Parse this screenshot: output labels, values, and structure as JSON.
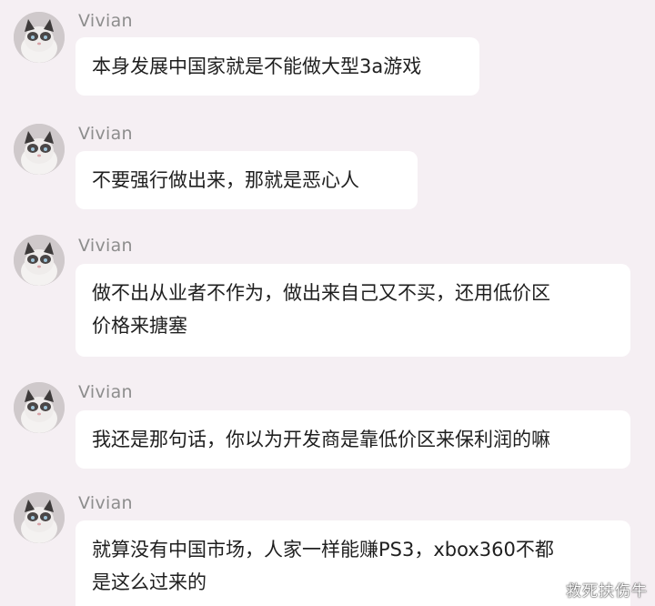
{
  "messages": [
    {
      "sender": "Vivian",
      "text": "本身发展中国家就是不能做大型3a游戏",
      "avatar_icon": "cat-avatar-icon"
    },
    {
      "sender": "Vivian",
      "text": "不要强行做出来，那就是恶心人",
      "avatar_icon": "cat-avatar-icon"
    },
    {
      "sender": "Vivian",
      "text": "做不出从业者不作为，做出来自己又不买，还用低价区\n价格来搪塞",
      "avatar_icon": "cat-avatar-icon"
    },
    {
      "sender": "Vivian",
      "text": "我还是那句话，你以为开发商是靠低价区来保利润的嘛",
      "avatar_icon": "cat-avatar-icon"
    },
    {
      "sender": "Vivian",
      "text": "就算没有中国市场，人家一样能赚PS3，xbox360不都\n是这么过来的",
      "avatar_icon": "cat-avatar-icon"
    }
  ],
  "watermark": "救死扶伤牛",
  "colors": {
    "background": "#f5eff3",
    "bubble": "#ffffff",
    "sender_name": "#8d8d8d",
    "text": "#1f1f1f"
  }
}
